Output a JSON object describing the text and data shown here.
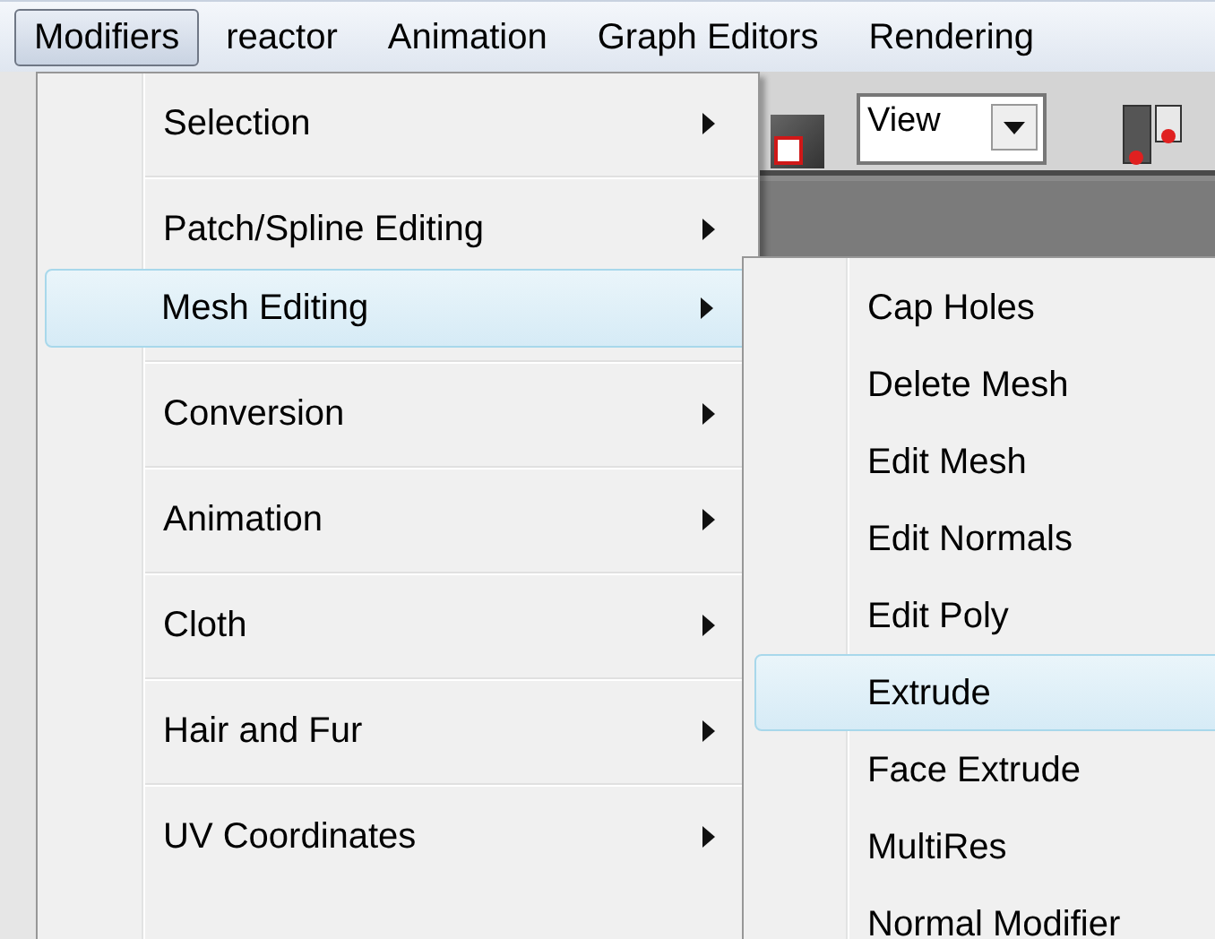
{
  "menubar": [
    {
      "label": "Modifiers",
      "selected": true
    },
    {
      "label": "reactor",
      "selected": false
    },
    {
      "label": "Animation",
      "selected": false
    },
    {
      "label": "Graph Editors",
      "selected": false
    },
    {
      "label": "Rendering",
      "selected": false
    }
  ],
  "toolbar": {
    "view_dropdown": {
      "value": "View"
    }
  },
  "menu": [
    {
      "kind": "item",
      "label": "Selection",
      "selected": false,
      "submenu": true
    },
    {
      "kind": "separator"
    },
    {
      "kind": "item",
      "label": "Patch/Spline Editing",
      "selected": false,
      "submenu": true
    },
    {
      "kind": "item",
      "label": "Mesh Editing",
      "selected": true,
      "submenu": true
    },
    {
      "kind": "separator"
    },
    {
      "kind": "item",
      "label": "Conversion",
      "selected": false,
      "submenu": true
    },
    {
      "kind": "separator"
    },
    {
      "kind": "item",
      "label": "Animation",
      "selected": false,
      "submenu": true
    },
    {
      "kind": "separator"
    },
    {
      "kind": "item",
      "label": "Cloth",
      "selected": false,
      "submenu": true
    },
    {
      "kind": "separator"
    },
    {
      "kind": "item",
      "label": "Hair and Fur",
      "selected": false,
      "submenu": true
    },
    {
      "kind": "separator"
    },
    {
      "kind": "item",
      "label": "UV Coordinates",
      "selected": false,
      "submenu": true
    }
  ],
  "submenu": [
    {
      "label": "Cap Holes",
      "selected": false
    },
    {
      "label": "Delete Mesh",
      "selected": false
    },
    {
      "label": "Edit Mesh",
      "selected": false
    },
    {
      "label": "Edit Normals",
      "selected": false
    },
    {
      "label": "Edit Poly",
      "selected": false
    },
    {
      "label": "Extrude",
      "selected": true
    },
    {
      "label": "Face Extrude",
      "selected": false
    },
    {
      "label": "MultiRes",
      "selected": false
    },
    {
      "label": "Normal Modifier",
      "selected": false
    }
  ]
}
